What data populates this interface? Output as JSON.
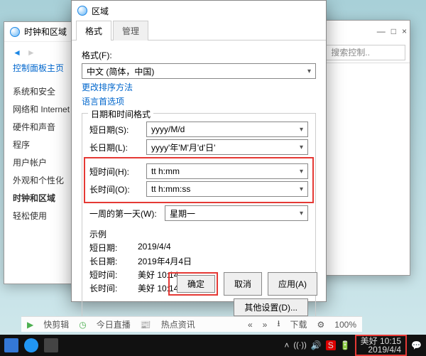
{
  "bg_window": {
    "search_placeholder": "搜索控制..",
    "min": "—",
    "max": "□",
    "close": "×"
  },
  "cp": {
    "title": "时钟和区域",
    "home": "控制面板主页",
    "items": [
      "系统和安全",
      "网络和 Internet",
      "硬件和声音",
      "程序",
      "用户帐户",
      "外观和个性化",
      "时钟和区域",
      "轻松使用"
    ],
    "active_index": 6
  },
  "region": {
    "title": "区域",
    "tabs": [
      "格式",
      "管理"
    ],
    "format_label": "格式(F):",
    "format_value": "中文 (简体，中国)",
    "link_change": "更改排序方法",
    "link_lang": "语言首选项",
    "group_datetime": "日期和时间格式",
    "rows": {
      "short_date": {
        "label": "短日期(S):",
        "value": "yyyy/M/d"
      },
      "long_date": {
        "label": "长日期(L):",
        "value": "yyyy'年'M'月'd'日'"
      },
      "short_time": {
        "label": "短时间(H):",
        "value": "tt h:mm"
      },
      "long_time": {
        "label": "长时间(O):",
        "value": "tt h:mm:ss"
      },
      "first_day": {
        "label": "一周的第一天(W):",
        "value": "星期一"
      }
    },
    "example_title": "示例",
    "examples": {
      "short_date": {
        "k": "短日期:",
        "v": "2019/4/4"
      },
      "long_date": {
        "k": "长日期:",
        "v": "2019年4月4日"
      },
      "short_time": {
        "k": "短时间:",
        "v": "美好 10:14"
      },
      "long_time": {
        "k": "长时间:",
        "v": "美好 10:14:06"
      }
    },
    "btn_more": "其他设置(D)...",
    "btn_ok": "确定",
    "btn_cancel": "取消",
    "btn_apply": "应用(A)"
  },
  "appbar": {
    "fast": "快剪辑",
    "live": "今日直播",
    "hot": "热点资讯",
    "down": "下载",
    "zoom": "100%",
    "cog": "⚙"
  },
  "taskbar": {
    "clock_time": "美好 10:15",
    "clock_date": "2019/4/4"
  }
}
